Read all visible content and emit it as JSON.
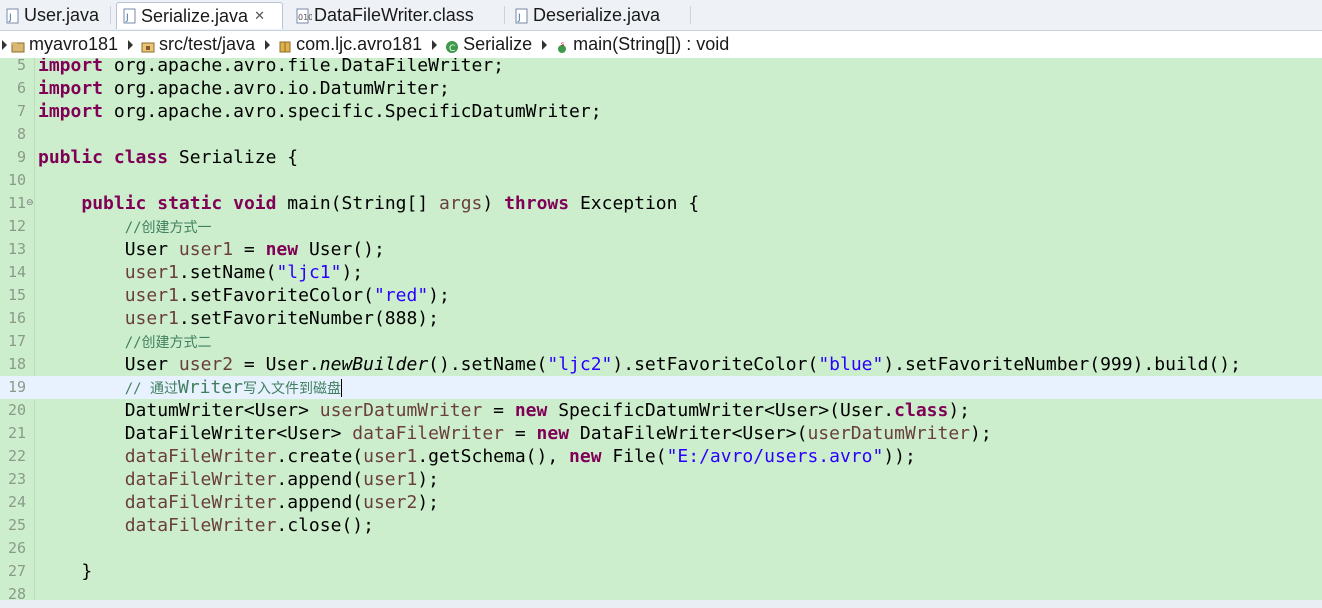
{
  "tabs": [
    {
      "label": "User.java",
      "icon": "java-file-icon",
      "active": false
    },
    {
      "label": "Serialize.java",
      "icon": "java-file-icon",
      "active": true,
      "close": "✕"
    },
    {
      "label": "DataFileWriter.class",
      "icon": "class-file-icon",
      "active": false
    },
    {
      "label": "Deserialize.java",
      "icon": "java-file-icon",
      "active": false
    }
  ],
  "breadcrumb": [
    {
      "label": "myavro181",
      "icon": "project-icon"
    },
    {
      "label": "src/test/java",
      "icon": "source-folder-icon"
    },
    {
      "label": "com.ljc.avro181",
      "icon": "package-icon"
    },
    {
      "label": "Serialize",
      "icon": "class-icon"
    },
    {
      "label": "main(String[]) : void",
      "icon": "method-icon"
    }
  ],
  "editor": {
    "line_numbers": [
      "5",
      "6",
      "7",
      "8",
      "9",
      "10",
      "11",
      "12",
      "13",
      "14",
      "15",
      "16",
      "17",
      "18",
      "19",
      "20",
      "21",
      "22",
      "23",
      "24",
      "25",
      "26",
      "27",
      "28"
    ],
    "current_line": "19",
    "lines": {
      "l5": [
        "import",
        " org.apache.avro.file.DataFileWriter;"
      ],
      "l6": [
        "import",
        " org.apache.avro.io.DatumWriter;"
      ],
      "l7": [
        "import",
        " org.apache.avro.specific.SpecificDatumWriter;"
      ],
      "l9": [
        "public",
        " ",
        "class",
        " Serialize {"
      ],
      "l11": [
        "    ",
        "public",
        " ",
        "static",
        " ",
        "void",
        " main(String[] ",
        "args",
        ") ",
        "throws",
        " Exception {"
      ],
      "l12": [
        "        ",
        "//创建方式一"
      ],
      "l13": [
        "        User ",
        "user1",
        " = ",
        "new",
        " User();"
      ],
      "l14": [
        "        ",
        "user1",
        ".setName(",
        "\"ljc1\"",
        ");"
      ],
      "l15": [
        "        ",
        "user1",
        ".setFavoriteColor(",
        "\"red\"",
        ");"
      ],
      "l16": [
        "        ",
        "user1",
        ".setFavoriteNumber(888);"
      ],
      "l17": [
        "        ",
        "//创建方式二"
      ],
      "l18": [
        "        User ",
        "user2",
        " = User.",
        "newBuilder",
        "().setName(",
        "\"ljc2\"",
        ").setFavoriteColor(",
        "\"blue\"",
        ").setFavoriteNumber(999).build();"
      ],
      "l19": [
        "        ",
        "// 通过",
        "Writer",
        "写入文件到磁盘"
      ],
      "l20": [
        "        DatumWriter<User> ",
        "userDatumWriter",
        " = ",
        "new",
        " SpecificDatumWriter<User>(User.",
        "class",
        ");"
      ],
      "l21": [
        "        DataFileWriter<User> ",
        "dataFileWriter",
        " = ",
        "new",
        " DataFileWriter<User>(",
        "userDatumWriter",
        ");"
      ],
      "l22": [
        "        ",
        "dataFileWriter",
        ".create(",
        "user1",
        ".getSchema(), ",
        "new",
        " File(",
        "\"E:/avro/users.avro\"",
        "));"
      ],
      "l23": [
        "        ",
        "dataFileWriter",
        ".append(",
        "user1",
        ");"
      ],
      "l24": [
        "        ",
        "dataFileWriter",
        ".append(",
        "user2",
        ");"
      ],
      "l25": [
        "        ",
        "dataFileWriter",
        ".close();"
      ],
      "l27": [
        "    }"
      ]
    }
  },
  "colors": {
    "editor_bg": "#cdeecd",
    "keyword": "#7f0055",
    "string": "#2a00ff",
    "comment": "#3f7f5f",
    "local_variable": "#6a3e3e",
    "current_line": "#e8f2fe"
  }
}
